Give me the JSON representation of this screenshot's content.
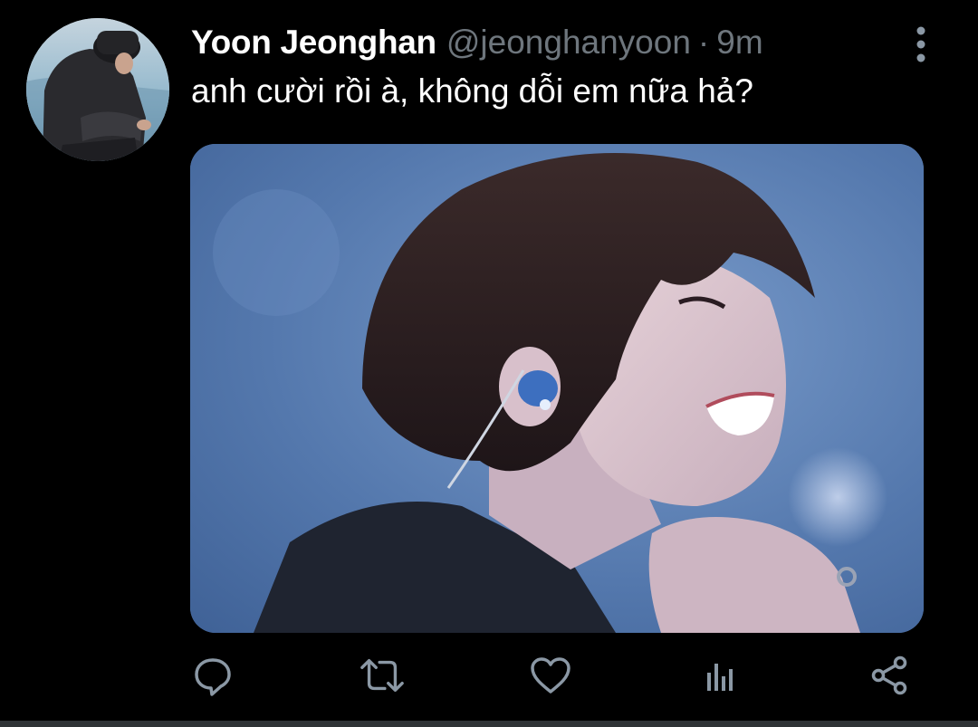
{
  "tweet": {
    "display_name": "Yoon Jeonghan",
    "handle": "@jeonghanyoon",
    "separator": "·",
    "time": "9m",
    "text": "anh cười rồi à, không dỗi em nữa hả?"
  },
  "avatar": {
    "icon": "user-avatar"
  },
  "media": {
    "icon": "photo"
  },
  "actions": [
    {
      "name": "reply",
      "icon": "speech-bubble-icon"
    },
    {
      "name": "retweet",
      "icon": "retweet-icon"
    },
    {
      "name": "like",
      "icon": "heart-icon"
    },
    {
      "name": "analytics",
      "icon": "bar-chart-icon"
    },
    {
      "name": "share",
      "icon": "share-icon"
    }
  ],
  "colors": {
    "background": "#000000",
    "text_primary": "#ffffff",
    "text_secondary": "#6e767d",
    "icon": "#8b98a5",
    "divider": "#2f3336"
  }
}
